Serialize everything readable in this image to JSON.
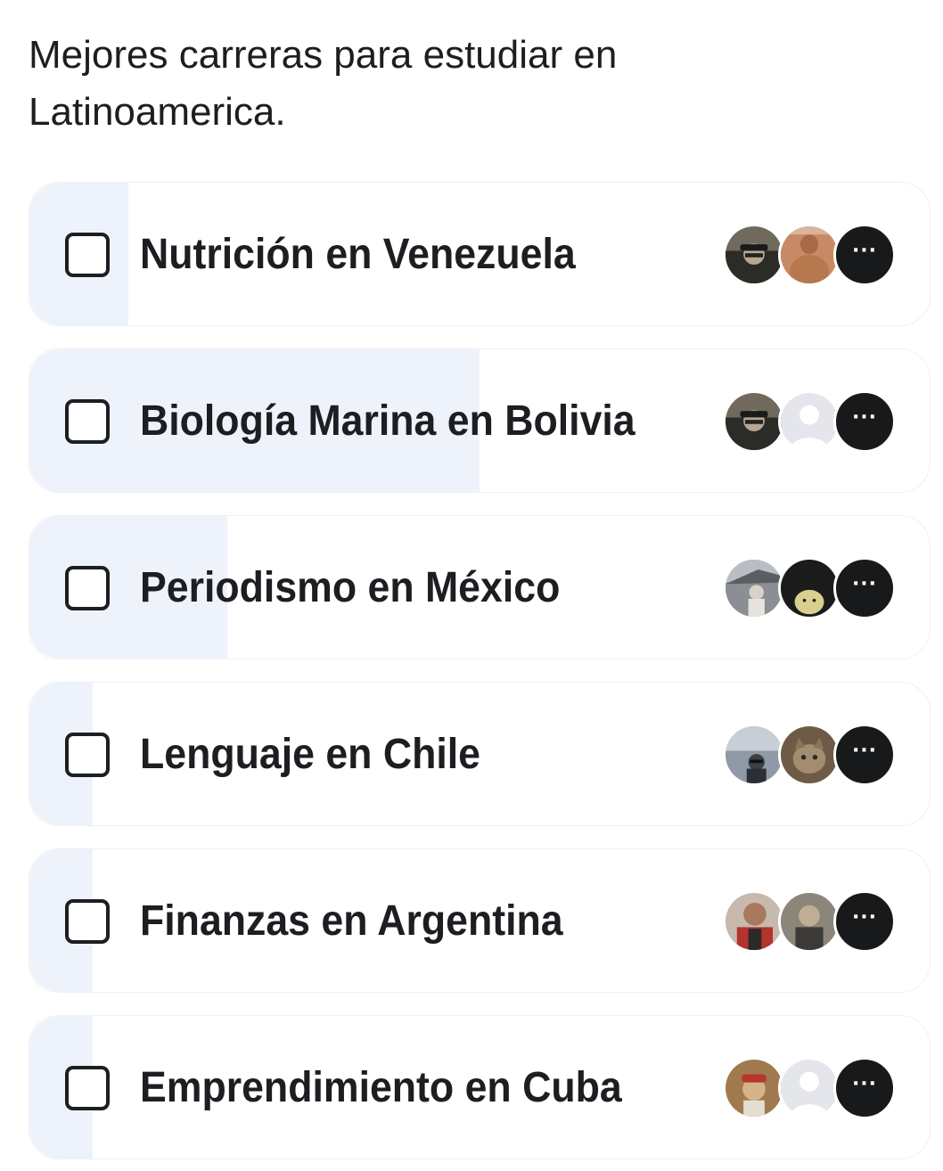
{
  "poll": {
    "question": "Mejores carreras para estudiar en Latinoamerica.",
    "options": [
      {
        "label": "Nutrición en Venezuela",
        "vote_share": 0.11,
        "voters": [
          "photo-avatar-man-cap",
          "photo-avatar-shirtless",
          "more-voters"
        ],
        "more_label": "···"
      },
      {
        "label": "Biología Marina en Bolivia",
        "vote_share": 0.5,
        "voters": [
          "photo-avatar-man-cap",
          "default-profile-avatar",
          "more-voters"
        ],
        "more_label": "···"
      },
      {
        "label": "Periodismo en México",
        "vote_share": 0.22,
        "voters": [
          "photo-avatar-outdoor",
          "photo-avatar-duck",
          "more-voters"
        ],
        "more_label": "···"
      },
      {
        "label": "Lenguaje en Chile",
        "vote_share": 0.07,
        "voters": [
          "photo-avatar-car-selfie",
          "photo-avatar-cat",
          "more-voters"
        ],
        "more_label": "···"
      },
      {
        "label": "Finanzas en Argentina",
        "vote_share": 0.07,
        "voters": [
          "photo-avatar-red-shirt",
          "photo-avatar-man",
          "more-voters"
        ],
        "more_label": "···"
      },
      {
        "label": "Emprendimiento en Cuba",
        "vote_share": 0.07,
        "voters": [
          "photo-avatar-red-cap",
          "default-profile-avatar",
          "more-voters"
        ],
        "more_label": "···"
      }
    ]
  },
  "colors": {
    "text": "#1c1e21",
    "option_fill": "#eef3fb",
    "option_border": "#edf0f4",
    "more_avatar_bg": "#18191a"
  }
}
